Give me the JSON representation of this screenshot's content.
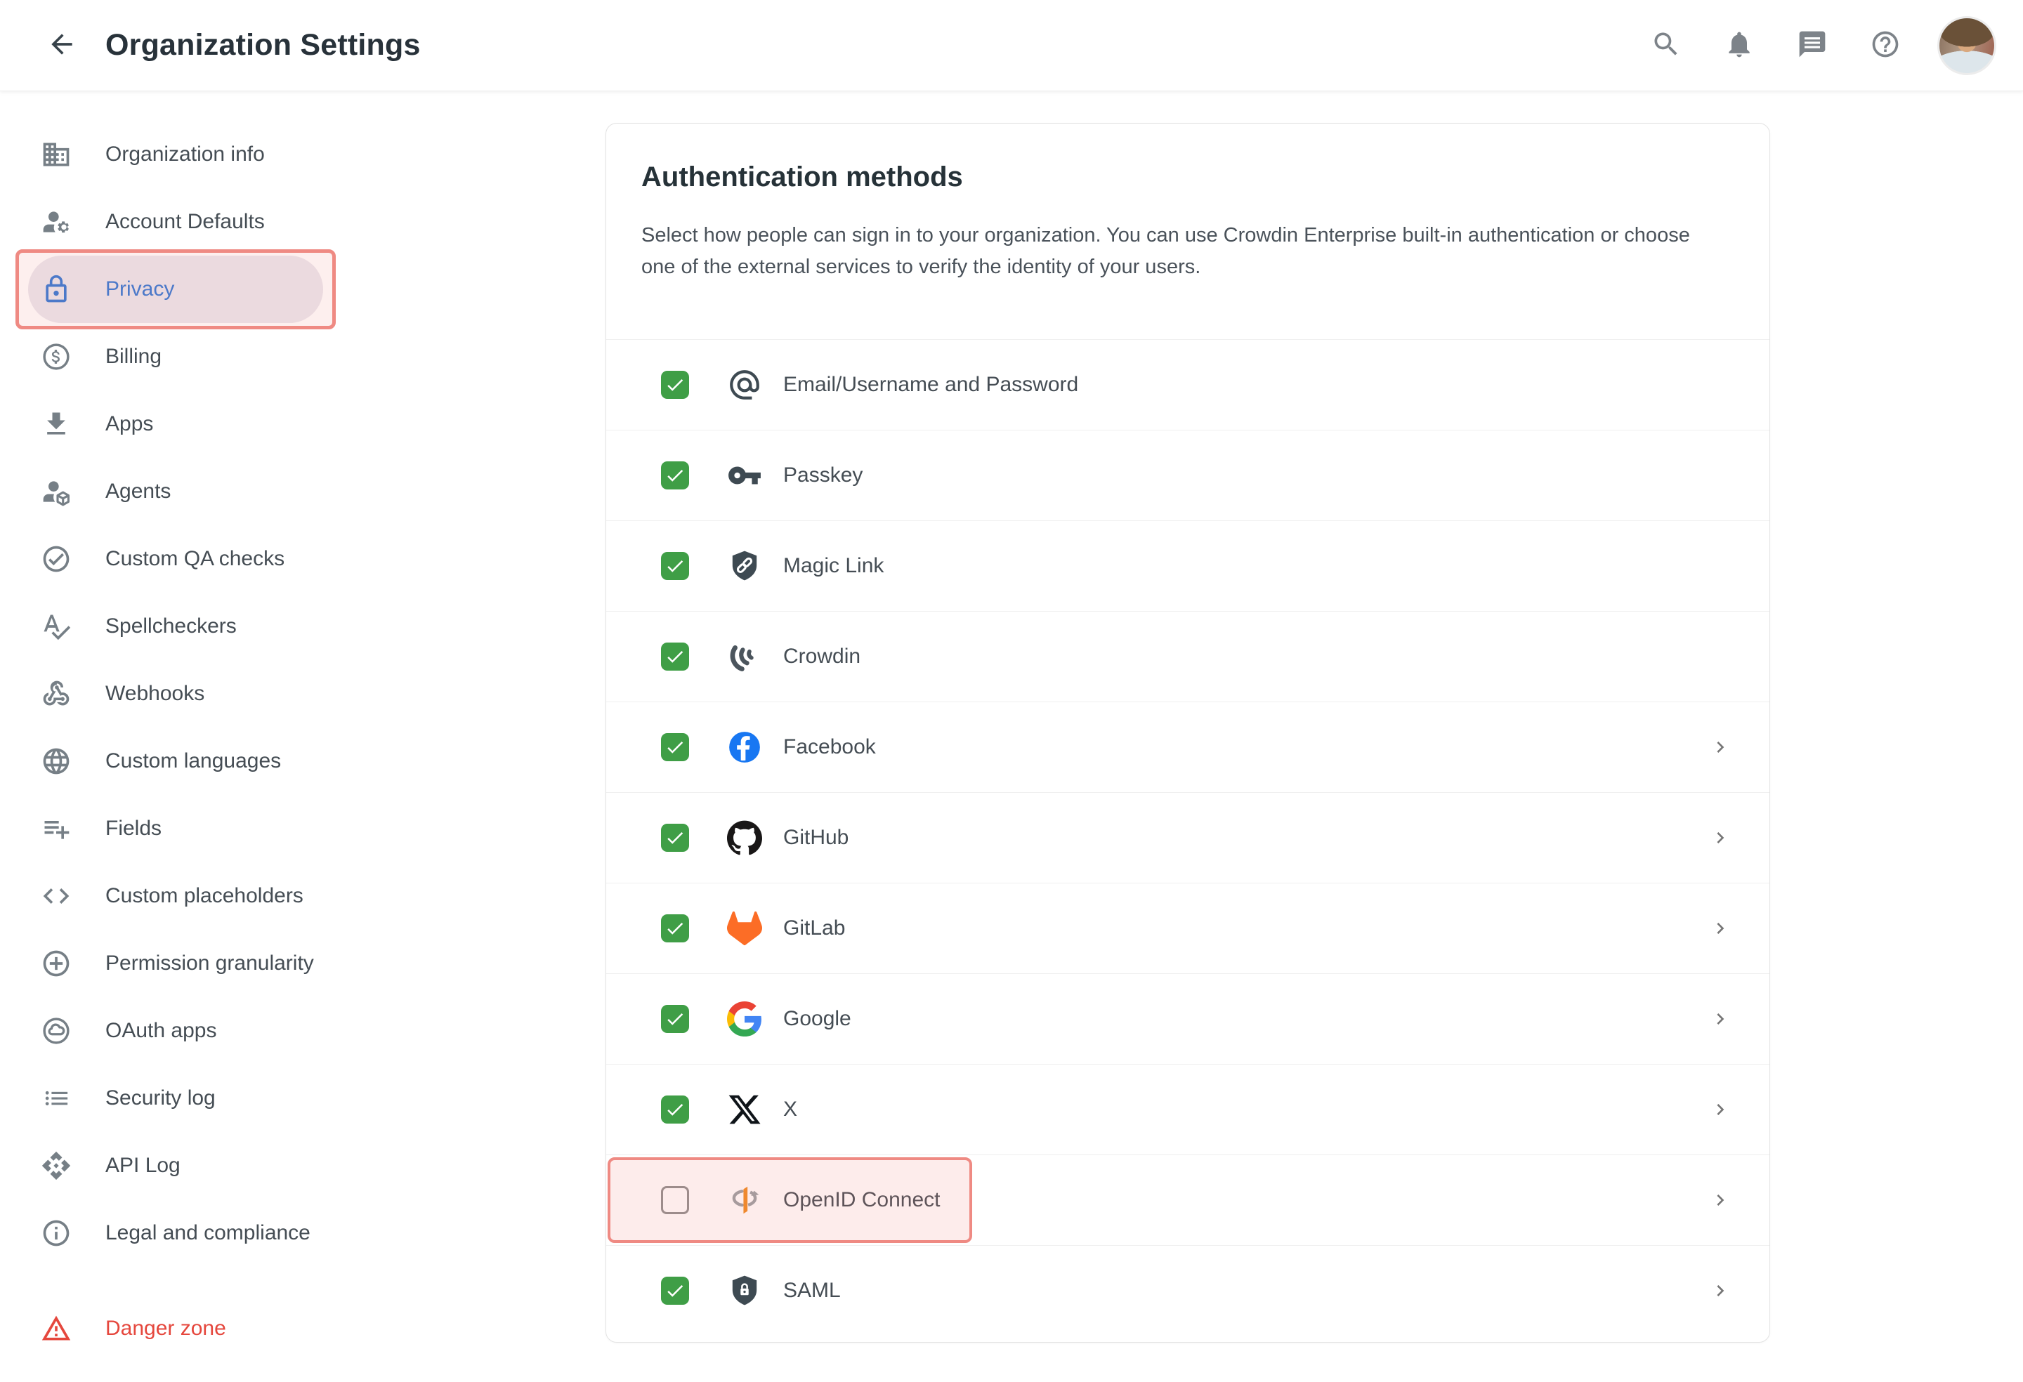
{
  "topbar": {
    "title": "Organization Settings",
    "icons": [
      "arrow-back-icon",
      "search-icon",
      "notifications-bell-icon",
      "chat-icon",
      "help-icon",
      "user-avatar"
    ]
  },
  "sidebar": {
    "items": [
      {
        "label": "Organization info",
        "icon": "building-icon"
      },
      {
        "label": "Account Defaults",
        "icon": "account-gear-icon"
      },
      {
        "label": "Privacy",
        "icon": "lock-icon",
        "selected": true,
        "annotated": true
      },
      {
        "label": "Billing",
        "icon": "dollar-circle-icon"
      },
      {
        "label": "Apps",
        "icon": "download-icon"
      },
      {
        "label": "Agents",
        "icon": "agent-cube-icon"
      },
      {
        "label": "Custom QA checks",
        "icon": "check-circle-icon"
      },
      {
        "label": "Spellcheckers",
        "icon": "spellcheck-icon"
      },
      {
        "label": "Webhooks",
        "icon": "webhook-icon"
      },
      {
        "label": "Custom languages",
        "icon": "globe-icon"
      },
      {
        "label": "Fields",
        "icon": "list-add-icon"
      },
      {
        "label": "Custom placeholders",
        "icon": "code-icon"
      },
      {
        "label": "Permission granularity",
        "icon": "plus-circle-icon"
      },
      {
        "label": "OAuth apps",
        "icon": "cloud-circle-icon"
      },
      {
        "label": "Security log",
        "icon": "list-icon"
      },
      {
        "label": "API Log",
        "icon": "api-icon"
      },
      {
        "label": "Legal and compliance",
        "icon": "info-icon"
      },
      {
        "label": "Danger zone",
        "icon": "warning-icon",
        "danger": true
      }
    ]
  },
  "main": {
    "title": "Authentication methods",
    "description": "Select how people can sign in to your organization. You can use Crowdin Enterprise built-in authentication or choose one of the external services to verify the identity of your users.",
    "methods": [
      {
        "label": "Email/Username and Password",
        "icon": "email-at-icon",
        "checked": true,
        "chevron": false
      },
      {
        "label": "Passkey",
        "icon": "passkey-key-icon",
        "checked": true,
        "chevron": false
      },
      {
        "label": "Magic Link",
        "icon": "magic-link-shield-icon",
        "checked": true,
        "chevron": false
      },
      {
        "label": "Crowdin",
        "icon": "crowdin-icon",
        "checked": true,
        "chevron": false
      },
      {
        "label": "Facebook",
        "icon": "facebook-icon",
        "checked": true,
        "chevron": true
      },
      {
        "label": "GitHub",
        "icon": "github-icon",
        "checked": true,
        "chevron": true
      },
      {
        "label": "GitLab",
        "icon": "gitlab-icon",
        "checked": true,
        "chevron": true
      },
      {
        "label": "Google",
        "icon": "google-icon",
        "checked": true,
        "chevron": true
      },
      {
        "label": "X",
        "icon": "x-icon",
        "checked": true,
        "chevron": true
      },
      {
        "label": "OpenID Connect",
        "icon": "openid-icon",
        "checked": false,
        "chevron": true,
        "annotated": true
      },
      {
        "label": "SAML",
        "icon": "saml-shield-icon",
        "checked": true,
        "chevron": true
      }
    ]
  },
  "colors": {
    "checkbox_green": "#3f9e46",
    "selected_blue": "#3478d5",
    "annotation_red": "#ef8a83",
    "danger_red": "#e5473d"
  }
}
